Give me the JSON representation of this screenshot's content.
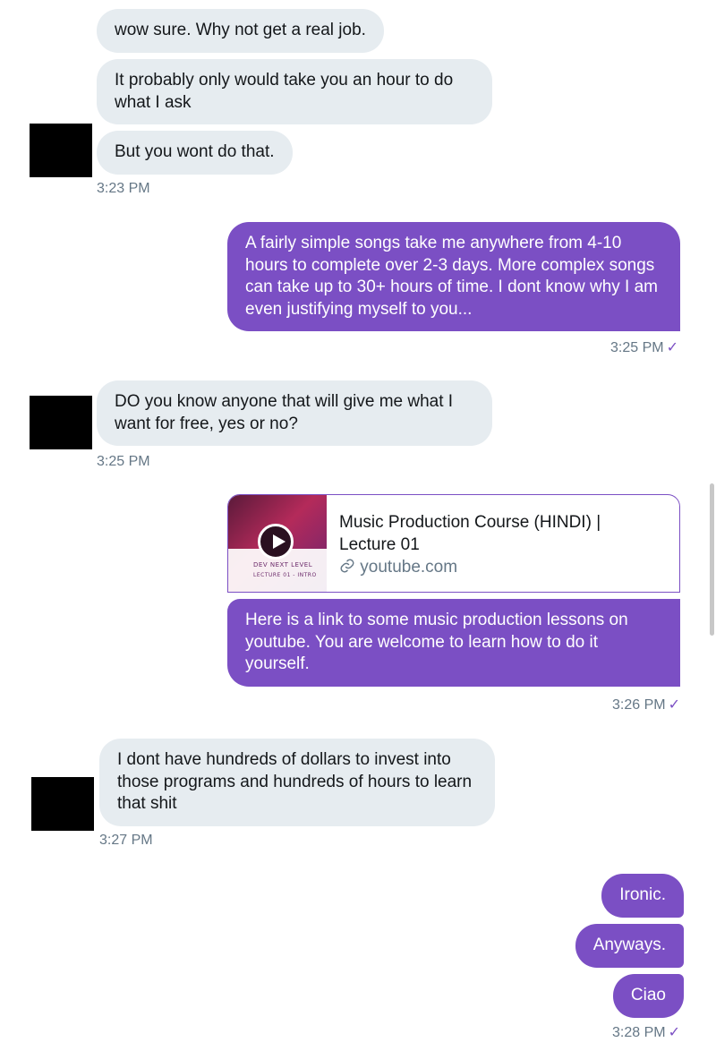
{
  "conversation": {
    "messages": [
      {
        "text": "wow sure. Why not get a real job."
      },
      {
        "text": "It probably only would take you an hour to do what I ask"
      },
      {
        "text": "But you wont do that."
      },
      {
        "text": "A fairly simple songs take me anywhere from 4-10 hours to complete over 2-3 days. More complex songs can take up to 30+ hours of time. I dont know why I am even justifying myself to you..."
      },
      {
        "text": "DO you know anyone that will give me what I want for free, yes or no?"
      },
      {
        "text": "Here is a link to some music production lessons on youtube. You are welcome to learn how to do it yourself."
      },
      {
        "text": "I dont have hundreds of dollars to invest into those programs and hundreds of hours to learn that shit"
      },
      {
        "text": "Ironic."
      },
      {
        "text": "Anyways."
      },
      {
        "text": "Ciao"
      }
    ],
    "timestamps": [
      "3:23 PM",
      "3:25 PM",
      "3:25 PM",
      "3:26 PM",
      "3:27 PM",
      "3:28 PM"
    ],
    "read_check": "✓",
    "link_card": {
      "title": "Music Production Course (HINDI) | Lecture 01",
      "domain": "youtube.com",
      "thumb_line1": "DEV NEXT LEVEL",
      "thumb_line2": "LECTURE 01 - INTRO"
    }
  },
  "colors": {
    "sent_bubble": "#7b4fc4",
    "received_bubble": "#e6ecf0",
    "timestamp": "#657786"
  }
}
